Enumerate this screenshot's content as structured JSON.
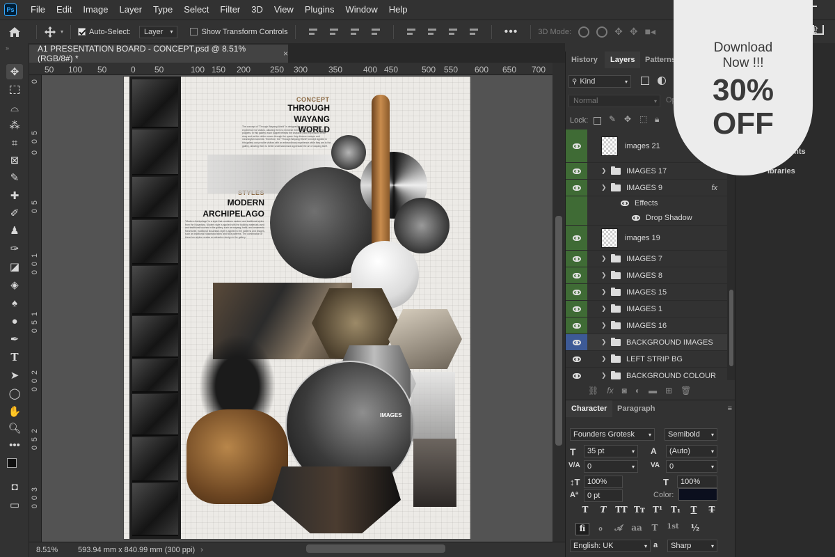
{
  "menubar": {
    "app_logo": "Ps",
    "items": [
      "File",
      "Edit",
      "Image",
      "Layer",
      "Type",
      "Select",
      "Filter",
      "3D",
      "View",
      "Plugins",
      "Window",
      "Help"
    ]
  },
  "options": {
    "auto_select_label": "Auto-Select:",
    "auto_select_target": "Layer",
    "show_transform_label": "Show Transform Controls",
    "mode_3d_label": "3D Mode:"
  },
  "tab": {
    "title": "A1 PRESENTATION BOARD - CONCEPT.psd @ 8.51% (RGB/8#) *",
    "close": "×"
  },
  "ruler": {
    "top_ticks": [
      "50",
      "100",
      "50",
      "0",
      "50",
      "100",
      "150",
      "200",
      "250",
      "300",
      "350",
      "400",
      "450",
      "500",
      "550",
      "600",
      "650",
      "700"
    ],
    "left_ticks": [
      "0",
      "5",
      "0",
      "0",
      "5",
      "0",
      "1",
      "0",
      "0",
      "1",
      "5",
      "0",
      "2",
      "0",
      "0",
      "2",
      "5",
      "0",
      "3",
      "0",
      "0"
    ]
  },
  "status": {
    "zoom": "8.51%",
    "doc_size": "593.94 mm x 840.99 mm (300 ppi)"
  },
  "board": {
    "concept_label": "CONCEPT",
    "concept_title_1": "THROUGH",
    "concept_title_2": "WAYANG WORLD",
    "concept_body": "The concept of \"Through Wayang World\" is designed to provide an engaging experience for visitors, allowing them to immerse themselves in the world of the puppets. In this gallery, each puppet reflects the character and expression of the story and as the visitor moves through the space they discover unique and meaningful moments. Therefore, the \"Through Wayang World\" concept applied in this gallery can provide visitors with an extraordinary experience while they are in the gallery, allowing them to better understand and appreciate the art of wayang itself.",
    "styles_label": "STYLES",
    "styles_title_1": "MODERN",
    "styles_title_2": "ARCHIPELAGO",
    "styles_body": "\"Modern Archipelago\" is a style that combines modern and traditional styles from the Nusantara. Modern style is applied with the building materials used and traditional touches in the gallery, such as wayang, batik, and ornaments. Meanwhile, traditional Nusantara style is applied to the patterns and images, such as traditional Nusantara fabric and flora patterns. The combination of these two styles creates an attractive design in the gallery.",
    "images_label": "IMAGES"
  },
  "layers_panel": {
    "tabs": [
      "History",
      "Layers",
      "Patterns"
    ],
    "filter_kind": "Kind",
    "blend_mode": "Normal",
    "opacity_label": "Op",
    "lock_label": "Lock:",
    "layers": [
      {
        "name": "images 21",
        "type": "image",
        "visible": true
      },
      {
        "name": "IMAGES 17",
        "type": "group",
        "visible": true
      },
      {
        "name": "IMAGES 9",
        "type": "group",
        "visible": true,
        "fx": "fx"
      },
      {
        "name": "Effects",
        "type": "effect",
        "visible": true
      },
      {
        "name": "Drop Shadow",
        "type": "effect",
        "visible": true
      },
      {
        "name": "images 19",
        "type": "image",
        "visible": true
      },
      {
        "name": "IMAGES 7",
        "type": "group",
        "visible": true
      },
      {
        "name": "IMAGES 8",
        "type": "group",
        "visible": true
      },
      {
        "name": "IMAGES 15",
        "type": "group",
        "visible": true
      },
      {
        "name": "IMAGES 1",
        "type": "group",
        "visible": true
      },
      {
        "name": "IMAGES 16",
        "type": "group",
        "visible": true
      },
      {
        "name": "BACKGROUND IMAGES",
        "type": "group",
        "visible": true,
        "selected": true
      },
      {
        "name": "LEFT STRIP BG",
        "type": "group",
        "visible": true
      },
      {
        "name": "BACKGROUND COLOUR",
        "type": "group",
        "visible": true
      }
    ],
    "colors": {
      "visible_bg": "#3f6b35",
      "selected_bg": "#3d5a96"
    }
  },
  "character_panel": {
    "tabs": [
      "Character",
      "Paragraph"
    ],
    "font_family": "Founders Grotesk",
    "font_style": "Semibold",
    "font_size": "35 pt",
    "leading": "(Auto)",
    "kerning": "0",
    "tracking": "0",
    "vertical_scale": "100%",
    "horizontal_scale": "100%",
    "baseline_shift": "0 pt",
    "color_label": "Color:",
    "color_value": "#0b0f1e",
    "language": "English: UK",
    "aa_label": "a",
    "antialias": "Sharp",
    "style_buttons": [
      "T",
      "T",
      "TT",
      "Tт",
      "T¹",
      "T₁",
      "T",
      "T"
    ],
    "opentype_buttons": [
      "fi",
      "ℴ",
      "𝒜",
      "aa",
      "T",
      "1st",
      "½"
    ]
  },
  "side_panel": {
    "items": [
      "ents",
      "ibraries"
    ]
  },
  "promo": {
    "line1": "Download",
    "line2": "Now !!!",
    "line3": "30%",
    "line4": "OFF"
  }
}
